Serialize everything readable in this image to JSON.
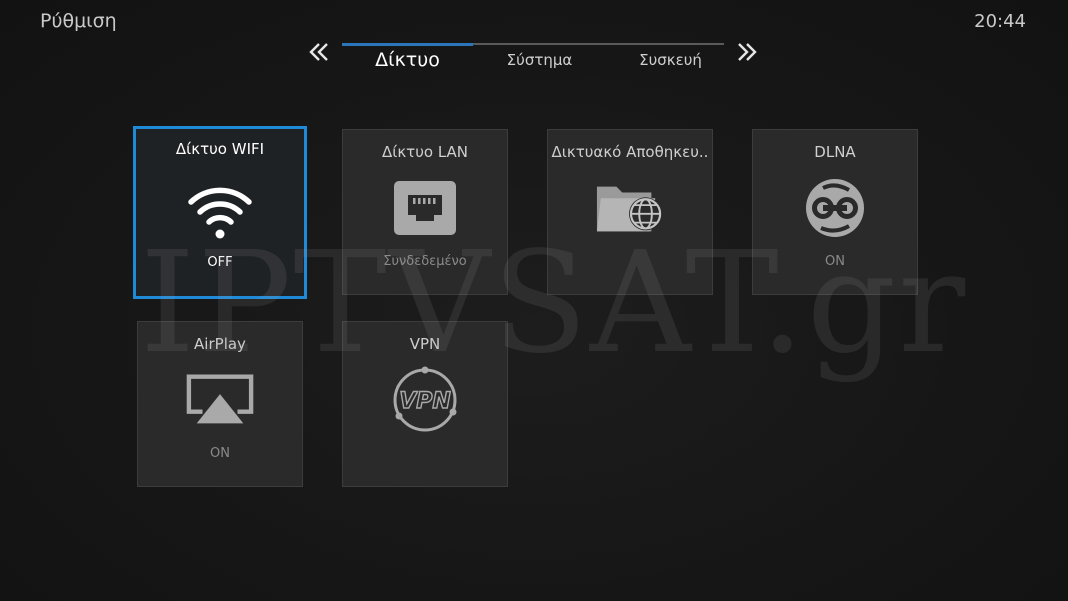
{
  "header": {
    "title": "Ρύθμιση",
    "clock": "20:44"
  },
  "tabs": [
    {
      "label": "Δίκτυο",
      "active": true
    },
    {
      "label": "Σύστημα",
      "active": false
    },
    {
      "label": "Συσκευή",
      "active": false
    }
  ],
  "watermark": "IPTVSAT.gr",
  "tiles": [
    {
      "label": "Δίκτυο WIFI",
      "status": "OFF",
      "icon": "wifi-icon"
    },
    {
      "label": "Δίκτυο LAN",
      "status": "Συνδεδεμένο",
      "icon": "ethernet-icon"
    },
    {
      "label": "Δικτυακό Αποθηκευ..",
      "status": "",
      "icon": "network-folder-icon"
    },
    {
      "label": "DLNA",
      "status": "ON",
      "icon": "dlna-icon"
    },
    {
      "label": "AirPlay",
      "status": "ON",
      "icon": "airplay-icon"
    },
    {
      "label": "VPN",
      "status": "",
      "icon": "vpn-icon"
    }
  ],
  "colors": {
    "focus": "#1e8ad8",
    "tab_active": "#2a76b8",
    "tile_bg": "#2a2a2a",
    "background": "#151515"
  }
}
